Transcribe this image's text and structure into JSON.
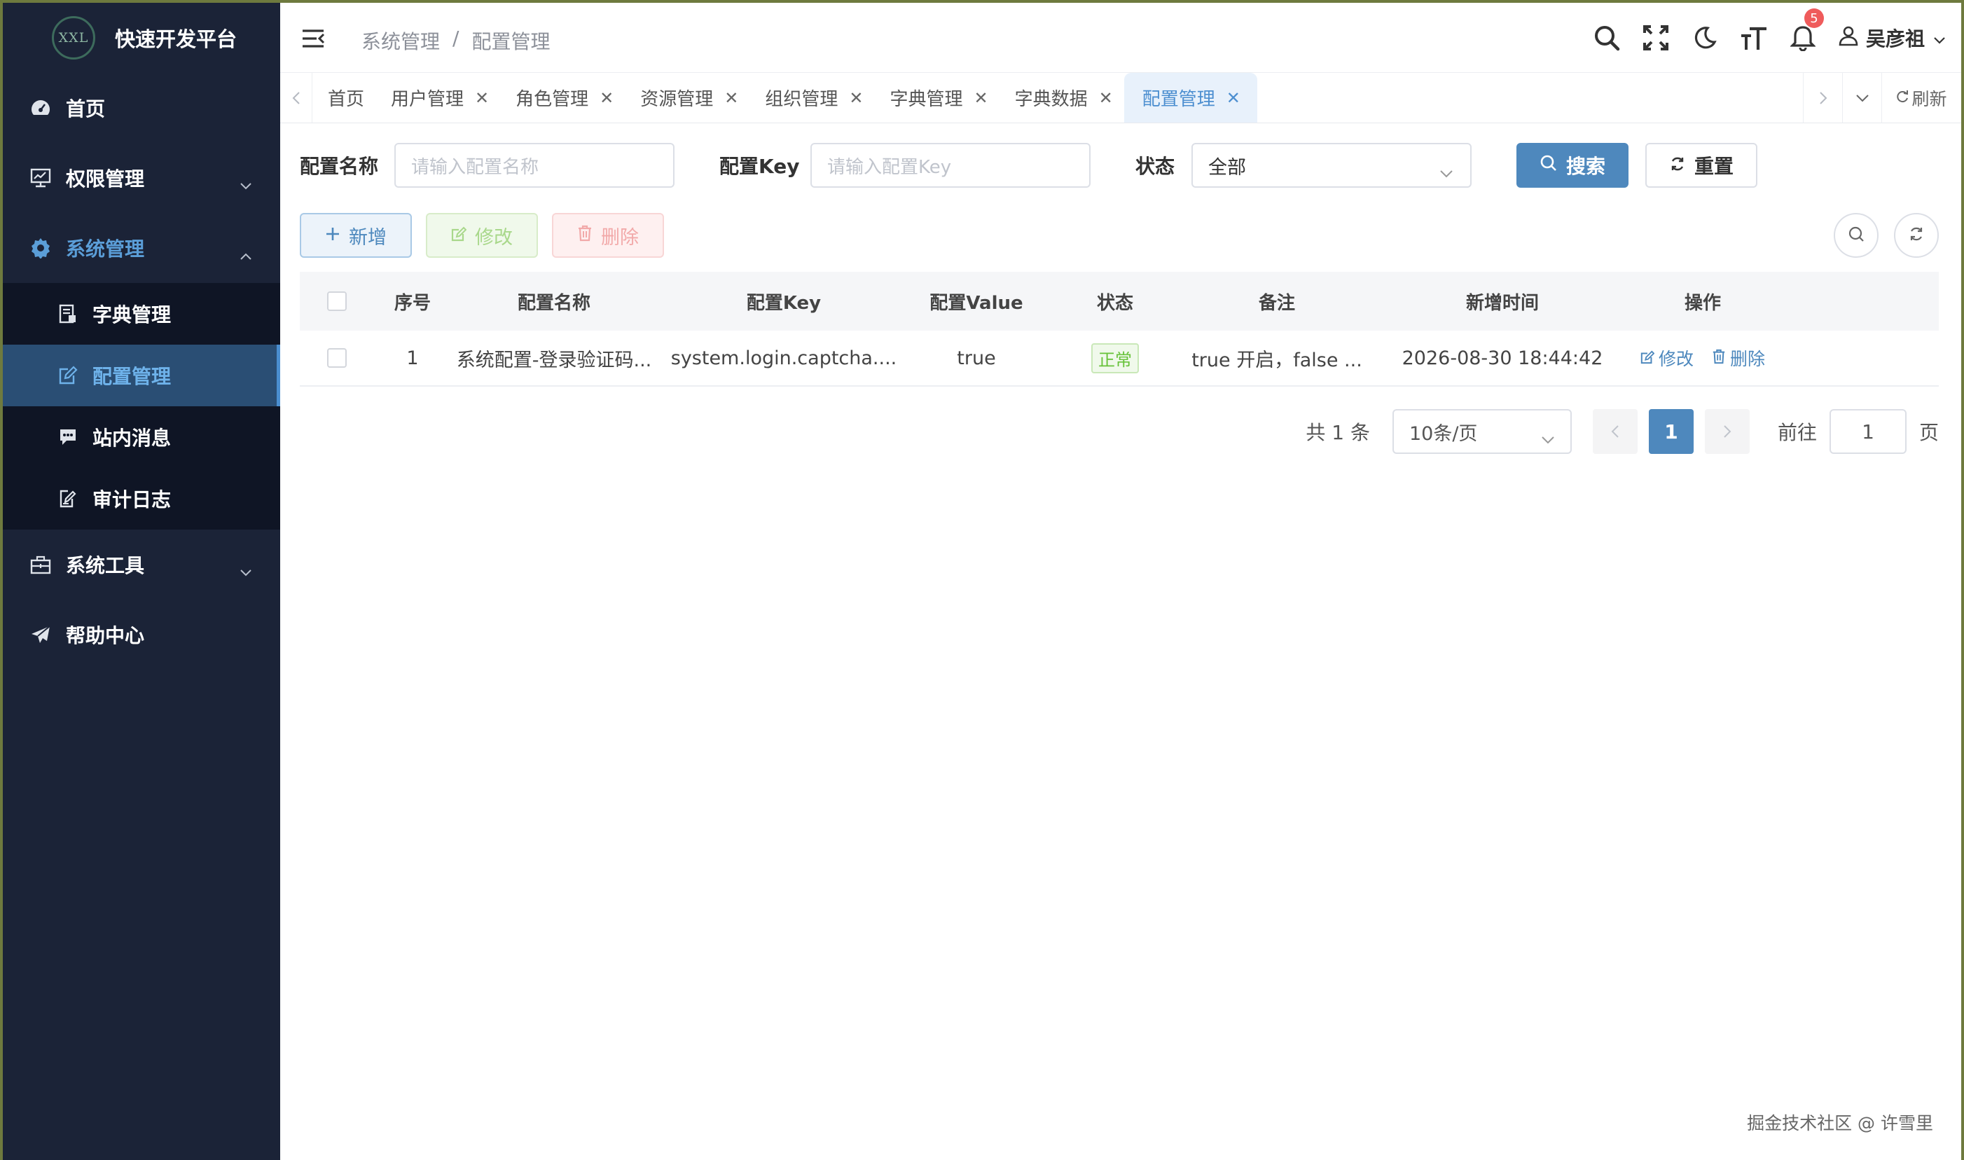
{
  "sidebar": {
    "logo_mark": "XXL",
    "title": "快速开发平台",
    "items": [
      {
        "label": "首页"
      },
      {
        "label": "权限管理"
      },
      {
        "label": "系统管理"
      },
      {
        "label": "系统工具"
      },
      {
        "label": "帮助中心"
      }
    ],
    "submenu": [
      {
        "label": "字典管理"
      },
      {
        "label": "配置管理"
      },
      {
        "label": "站内消息"
      },
      {
        "label": "审计日志"
      }
    ]
  },
  "header": {
    "breadcrumb": [
      "系统管理",
      "配置管理"
    ],
    "breadcrumb_sep": "/",
    "notification_count": "5",
    "user_name": "吴彦祖"
  },
  "tabs": [
    {
      "label": "首页"
    },
    {
      "label": "用户管理"
    },
    {
      "label": "角色管理"
    },
    {
      "label": "资源管理"
    },
    {
      "label": "组织管理"
    },
    {
      "label": "字典管理"
    },
    {
      "label": "字典数据"
    },
    {
      "label": "配置管理"
    }
  ],
  "tabs_refresh": "刷新",
  "filters": {
    "name_label": "配置名称",
    "name_placeholder": "请输入配置名称",
    "key_label": "配置Key",
    "key_placeholder": "请输入配置Key",
    "status_label": "状态",
    "status_value": "全部",
    "search_label": "搜索",
    "reset_label": "重置"
  },
  "actions": {
    "add": "新增",
    "edit": "修改",
    "delete": "删除"
  },
  "table": {
    "headers": [
      "序号",
      "配置名称",
      "配置Key",
      "配置Value",
      "状态",
      "备注",
      "新增时间",
      "操作"
    ],
    "rows": [
      {
        "index": "1",
        "name": "系统配置-登录验证码...",
        "key": "system.login.captcha....",
        "value": "true",
        "status": "正常",
        "remark": "true 开启，false ...",
        "created": "2026-08-30 18:44:42",
        "op_edit": "修改",
        "op_delete": "删除"
      }
    ]
  },
  "pagination": {
    "total": "共 1 条",
    "page_size": "10条/页",
    "current": "1",
    "goto_label": "前往",
    "goto_value": "1",
    "page_suffix": "页"
  },
  "watermark": "掘金技术社区 @ 许雪里",
  "colors": {
    "sidebar_bg": "#1b2337",
    "primary": "#4e88bd",
    "active_menu": "#5b9ed8",
    "success": "#67c23a",
    "danger": "#ef5b5b"
  }
}
